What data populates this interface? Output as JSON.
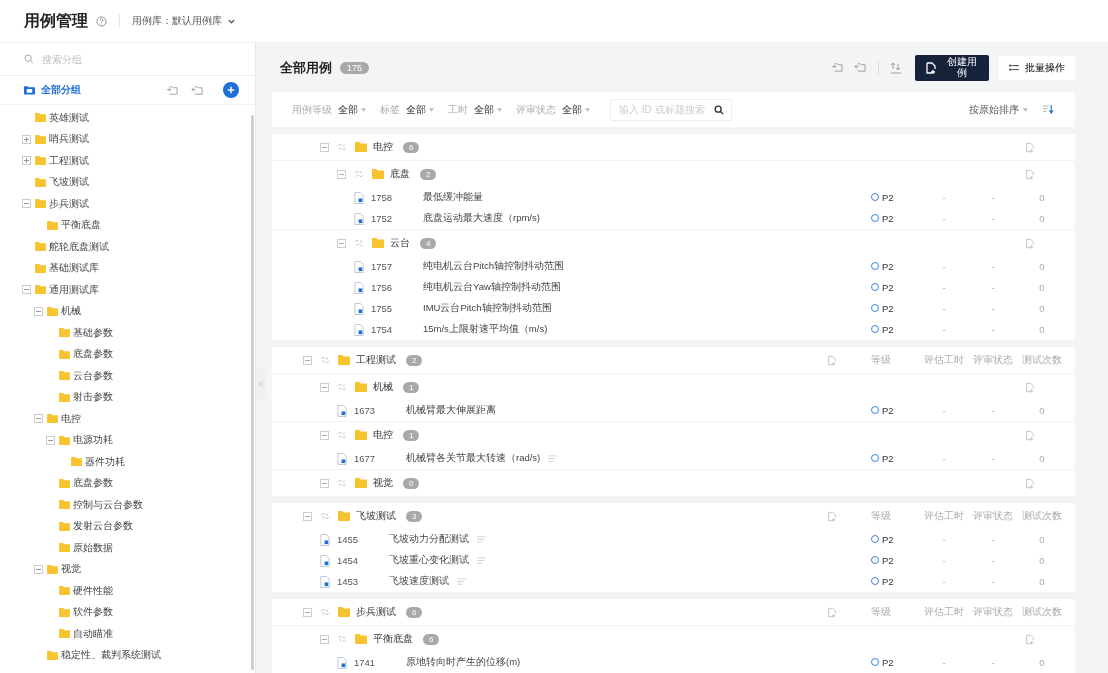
{
  "header": {
    "title": "用例管理",
    "library": "用例库：默认用例库"
  },
  "sidebar": {
    "search": {
      "placeholder": "搜索分组"
    },
    "all_groups": {
      "label": "全部分组",
      "selected": true
    },
    "tree": [
      {
        "name": "英雄测试"
      },
      {
        "name": "哨兵测试",
        "expanded": false
      },
      {
        "name": "工程测试",
        "expanded": false
      },
      {
        "name": "飞坡测试"
      },
      {
        "name": "步兵测试",
        "expanded": true,
        "children": [
          {
            "name": "平衡底盘"
          }
        ]
      },
      {
        "name": "舵轮底盘测试"
      },
      {
        "name": "基础测试库"
      },
      {
        "name": "通用测试库",
        "expanded": true,
        "children": [
          {
            "name": "机械",
            "expanded": true,
            "children": [
              {
                "name": "基础参数"
              },
              {
                "name": "底盘参数"
              },
              {
                "name": "云台参数"
              },
              {
                "name": "射击参数"
              }
            ]
          },
          {
            "name": "电控",
            "expanded": true,
            "children": [
              {
                "name": "电源功耗",
                "expanded": true,
                "children": [
                  {
                    "name": "器件功耗"
                  }
                ]
              },
              {
                "name": "底盘参数"
              },
              {
                "name": "控制与云台参数"
              },
              {
                "name": "发射云台参数"
              },
              {
                "name": "原始数据"
              }
            ]
          },
          {
            "name": "视觉",
            "expanded": true,
            "children": [
              {
                "name": "硬件性能"
              },
              {
                "name": "软件参数"
              },
              {
                "name": "自动瞄准"
              }
            ]
          },
          {
            "name": "稳定性、裁判系统测试"
          }
        ]
      }
    ]
  },
  "main": {
    "title": "全部用例",
    "count": "175",
    "create_button": "创建用例",
    "batch_button": "批量操作",
    "filters": [
      {
        "label": "用例等级",
        "value": "全部"
      },
      {
        "label": "标签",
        "value": "全部"
      },
      {
        "label": "工时",
        "value": "全部"
      },
      {
        "label": "评审状态",
        "value": "全部"
      }
    ],
    "search": {
      "placeholder": "输入 ID 或标题搜索"
    },
    "sort": "按原始排序",
    "cards": [
      {
        "children": [
          {
            "kind": "group",
            "name": "电控",
            "count": "6",
            "expanded": true,
            "children": [
              {
                "kind": "group",
                "name": "底盘",
                "count": "2",
                "expanded": true,
                "children": [
                  {
                    "kind": "case",
                    "id": "1758",
                    "title": "最低缓冲能量",
                    "note": false,
                    "priority": "P2",
                    "hours": "-",
                    "review": "-",
                    "runs": "0"
                  },
                  {
                    "kind": "case",
                    "id": "1752",
                    "title": "底盘运动最大速度（rpm/s)",
                    "note": false,
                    "priority": "P2",
                    "hours": "-",
                    "review": "-",
                    "runs": "0"
                  }
                ]
              },
              {
                "kind": "group",
                "name": "云台",
                "count": "4",
                "expanded": true,
                "children": [
                  {
                    "kind": "case",
                    "id": "1757",
                    "title": "纯电机云台Pitch轴控制抖动范围",
                    "note": false,
                    "priority": "P2",
                    "hours": "-",
                    "review": "-",
                    "runs": "0"
                  },
                  {
                    "kind": "case",
                    "id": "1756",
                    "title": "纯电机云台Yaw轴控制抖动范围",
                    "note": false,
                    "priority": "P2",
                    "hours": "-",
                    "review": "-",
                    "runs": "0"
                  },
                  {
                    "kind": "case",
                    "id": "1755",
                    "title": "IMU云台Pitch轴控制抖动范围",
                    "note": false,
                    "priority": "P2",
                    "hours": "-",
                    "review": "-",
                    "runs": "0"
                  },
                  {
                    "kind": "case",
                    "id": "1754",
                    "title": "15m/s上限射速平均值（m/s)",
                    "note": false,
                    "priority": "P2",
                    "hours": "-",
                    "review": "-",
                    "runs": "0"
                  }
                ]
              }
            ]
          }
        ]
      },
      {
        "kind": "group",
        "name": "工程测试",
        "count": "2",
        "expanded": true,
        "columns": [
          "等级",
          "评估工时",
          "评审状态",
          "测试次数"
        ],
        "children": [
          {
            "kind": "group",
            "name": "机械",
            "count": "1",
            "expanded": true,
            "children": [
              {
                "kind": "case",
                "id": "1673",
                "title": "机械臂最大伸展距离",
                "note": false,
                "priority": "P2",
                "hours": "-",
                "review": "-",
                "runs": "0"
              }
            ]
          },
          {
            "kind": "group",
            "name": "电控",
            "count": "1",
            "expanded": true,
            "children": [
              {
                "kind": "case",
                "id": "1677",
                "title": "机械臂各关节最大转速（rad/s)",
                "note": true,
                "priority": "P2",
                "hours": "-",
                "review": "-",
                "runs": "0"
              }
            ]
          },
          {
            "kind": "group",
            "name": "视觉",
            "count": "0",
            "expanded": true
          }
        ]
      },
      {
        "kind": "group",
        "name": "飞坡测试",
        "count": "3",
        "expanded": true,
        "columns": [
          "等级",
          "评估工时",
          "评审状态",
          "测试次数"
        ],
        "children": [
          {
            "kind": "case",
            "id": "1455",
            "title": "飞坡动力分配测试",
            "note": true,
            "priority": "P2",
            "hours": "-",
            "review": "-",
            "runs": "0"
          },
          {
            "kind": "case",
            "id": "1454",
            "title": "飞坡重心变化测试",
            "note": true,
            "priority": "P2",
            "hours": "-",
            "review": "-",
            "runs": "0"
          },
          {
            "kind": "case",
            "id": "1453",
            "title": "飞坡速度测试",
            "note": true,
            "priority": "P2",
            "hours": "-",
            "review": "-",
            "runs": "0"
          }
        ]
      },
      {
        "kind": "group",
        "name": "步兵测试",
        "count": "6",
        "expanded": true,
        "columns": [
          "等级",
          "评估工时",
          "评审状态",
          "测试次数"
        ],
        "children": [
          {
            "kind": "group",
            "name": "平衡底盘",
            "count": "6",
            "expanded": true,
            "children": [
              {
                "kind": "case",
                "id": "1741",
                "title": "原地转向时产生的位移(m)",
                "note": false,
                "priority": "P2",
                "hours": "-",
                "review": "-",
                "runs": "0"
              }
            ]
          }
        ]
      }
    ]
  }
}
